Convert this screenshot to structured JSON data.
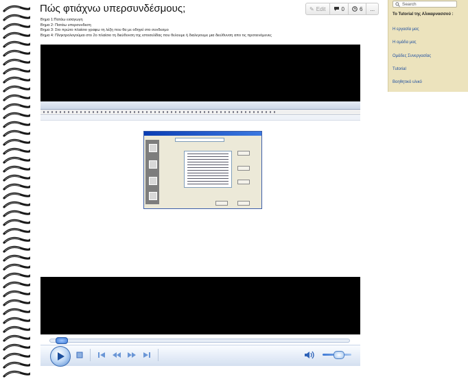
{
  "page": {
    "title": "Πώς φτιάχνω υπερσυνδέσμους;",
    "actions": {
      "edit_label": "Edit",
      "comments_count": "0",
      "history_count": "6",
      "more_label": "..."
    },
    "steps": [
      "Βημα 1:Πατάω εισαγωγη",
      "Βημα 2: Πατάω υπερσυνδεση",
      "Βημα 3: Στο πρώτο πλαίσιο γραφω τη λέξη που θα με οδηγεί στο συνδεσμο",
      "Βημα 4: Πληκτρολογούμαι στο 2ο πλαίσιο τη διεύθυνση της ιστοσελίδας που θελουμε ή διαλεγουμε μια διεύθυνση απο τις προτεινόμενες"
    ]
  },
  "sidebar": {
    "search_placeholder": "Search",
    "heading": "Το Tutorial της Αλικαρνασσού :",
    "links": [
      "Η εργασία μας",
      "Η ομάδα μας",
      "Ομάδες Συνεργασίας",
      "Tutorial",
      "Βοηθητικό υλικό"
    ]
  },
  "player": {
    "seek_progress": 0.02,
    "volume_level": 0.55
  },
  "colors": {
    "sidebar_bg": "#ece3bd",
    "link": "#1f4fa0",
    "player_accent": "#3d6fbf"
  }
}
